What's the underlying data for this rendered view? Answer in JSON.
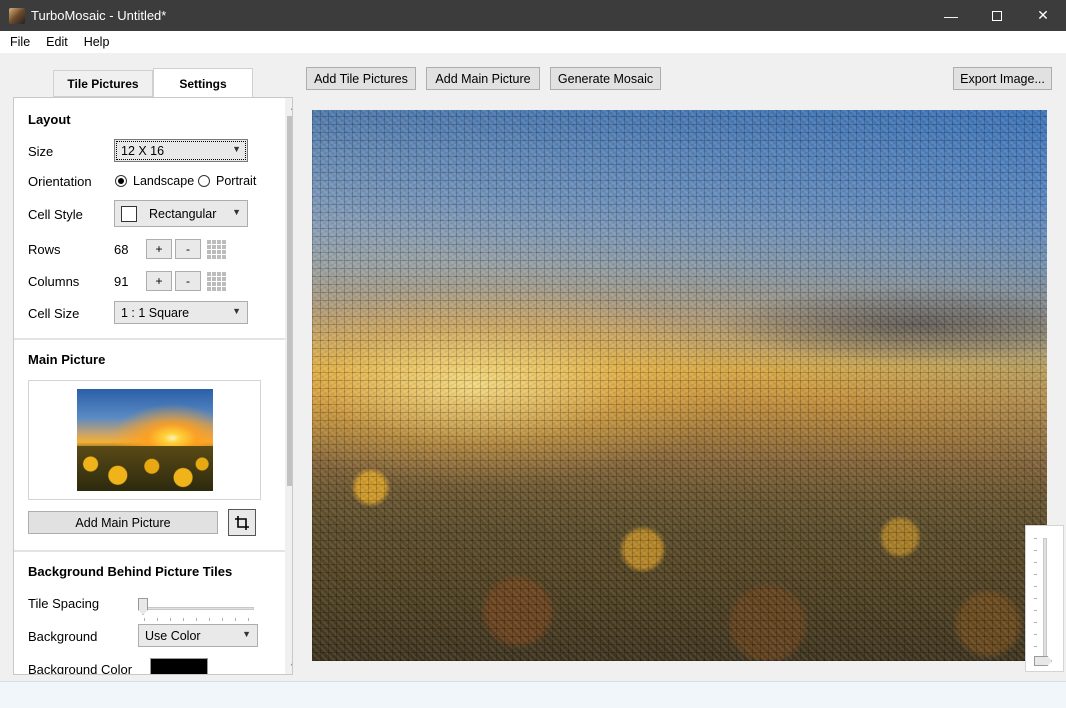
{
  "window": {
    "title": "TurboMosaic - Untitled*"
  },
  "menu": [
    "File",
    "Edit",
    "Help"
  ],
  "tabs": {
    "tiles": "Tile Pictures",
    "settings": "Settings"
  },
  "layout": {
    "heading": "Layout",
    "size_label": "Size",
    "size_value": "12 X 16",
    "orientation_label": "Orientation",
    "orientation_options": [
      "Landscape",
      "Portrait"
    ],
    "orientation_selected": "Landscape",
    "cell_style_label": "Cell Style",
    "cell_style_value": "Rectangular",
    "rows_label": "Rows",
    "rows_value": "68",
    "columns_label": "Columns",
    "columns_value": "91",
    "plus": "+",
    "minus": "-",
    "cell_size_label": "Cell Size",
    "cell_size_value": "1 : 1 Square"
  },
  "main_picture": {
    "heading": "Main Picture",
    "add_button": "Add Main Picture"
  },
  "background": {
    "heading": "Background Behind Picture Tiles",
    "tile_spacing_label": "Tile Spacing",
    "tile_spacing_value": 0,
    "background_label": "Background",
    "background_value": "Use Color",
    "background_color_label": "Background Color",
    "background_color": "#000000"
  },
  "toolbar": {
    "add_tiles": "Add Tile Pictures",
    "add_main": "Add Main Picture",
    "generate": "Generate Mosaic",
    "export": "Export Image..."
  },
  "zoom": {
    "level": 0
  }
}
